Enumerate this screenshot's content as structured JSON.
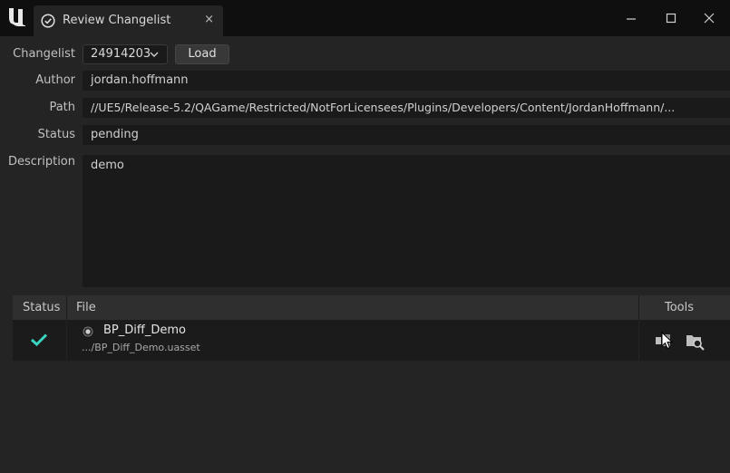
{
  "window": {
    "tab_title": "Review Changelist",
    "tab_close": "×"
  },
  "form": {
    "changelist_label": "Changelist",
    "changelist_value": "24914203",
    "load_label": "Load",
    "author_label": "Author",
    "author_value": "jordan.hoffmann",
    "path_label": "Path",
    "path_value": "//UE5/Release-5.2/QAGame/Restricted/NotForLicensees/Plugins/Developers/Content/JordanHoffmann/...",
    "status_label": "Status",
    "status_value": "pending",
    "description_label": "Description",
    "description_value": "demo"
  },
  "table": {
    "columns": [
      "Status",
      "File",
      "Tools"
    ],
    "rows": [
      {
        "status_icon": "check-icon",
        "file_name": "BP_Diff_Demo",
        "file_path": ".../BP_Diff_Demo.uasset",
        "tools": [
          "history-icon",
          "find-in-content-browser-icon"
        ]
      }
    ]
  },
  "colors": {
    "accent_check": "#3ad5c2",
    "panel_bg": "#242424",
    "titlebar_bg": "#0f0f0f"
  }
}
